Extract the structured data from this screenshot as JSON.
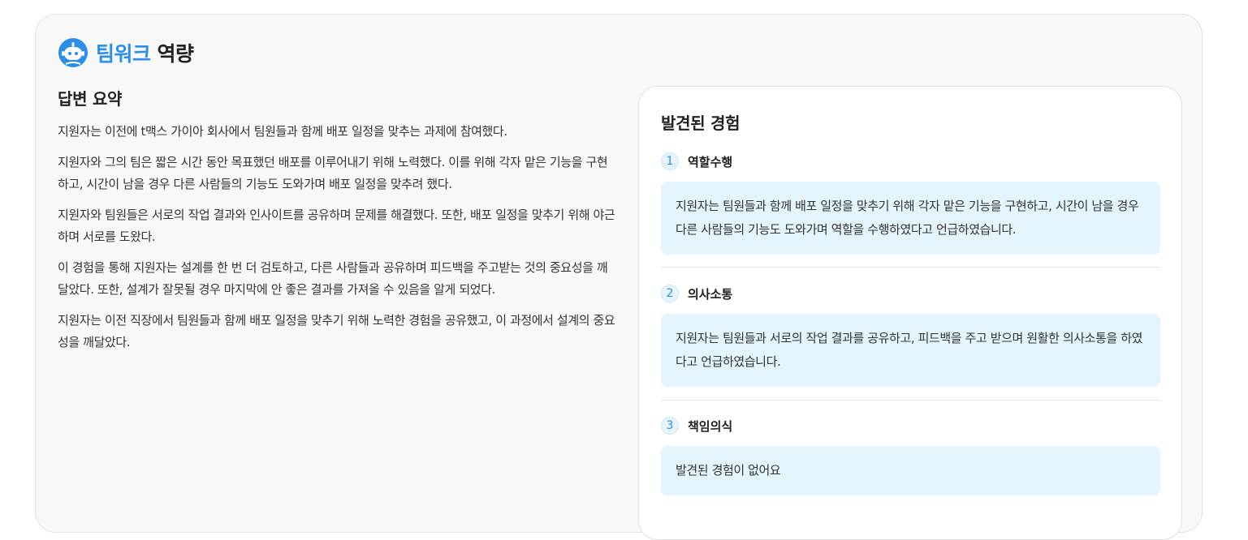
{
  "header": {
    "title_accent": "팀워크",
    "title_rest": "역량",
    "icon": "robot-icon",
    "accent_color": "#2b8ee8"
  },
  "summary": {
    "heading": "답변 요약",
    "paragraphs": [
      "지원자는 이전에 t맥스 가이아 회사에서 팀원들과 함께 배포 일정을 맞추는 과제에 참여했다.",
      "지원자와 그의 팀은 짧은 시간 동안 목표했던 배포를 이루어내기 위해 노력했다. 이를 위해 각자 맡은 기능을 구현하고, 시간이 남을 경우 다른 사람들의 기능도 도와가며 배포 일정을 맞추려 했다.",
      "지원자와 팀원들은 서로의 작업 결과와 인사이트를 공유하며 문제를 해결했다. 또한, 배포 일정을 맞추기 위해 야근하며 서로를 도왔다.",
      "이 경험을 통해 지원자는 설계를 한 번 더 검토하고, 다른 사람들과 공유하며 피드백을 주고받는 것의 중요성을 깨달았다. 또한, 설계가 잘못될 경우 마지막에 안 좋은 결과를 가져올 수 있음을 알게 되었다.",
      "지원자는 이전 직장에서 팀원들과 함께 배포 일정을 맞추기 위해 노력한 경험을 공유했고, 이 과정에서 설계의 중요성을 깨달았다."
    ]
  },
  "experiences": {
    "heading": "발견된 경험",
    "items": [
      {
        "number": "1",
        "label": "역할수행",
        "text": "지원자는 팀원들과 함께 배포 일정을 맞추기 위해 각자 맡은 기능을 구현하고, 시간이 남을 경우 다른 사람들의 기능도 도와가며 역할을 수행하였다고 언급하였습니다."
      },
      {
        "number": "2",
        "label": "의사소통",
        "text": "지원자는 팀원들과 서로의 작업 결과를 공유하고, 피드백을 주고 받으며 원활한 의사소통을 하였다고 언급하였습니다."
      },
      {
        "number": "3",
        "label": "책임의식",
        "text": "발견된 경험이 없어요"
      }
    ]
  }
}
